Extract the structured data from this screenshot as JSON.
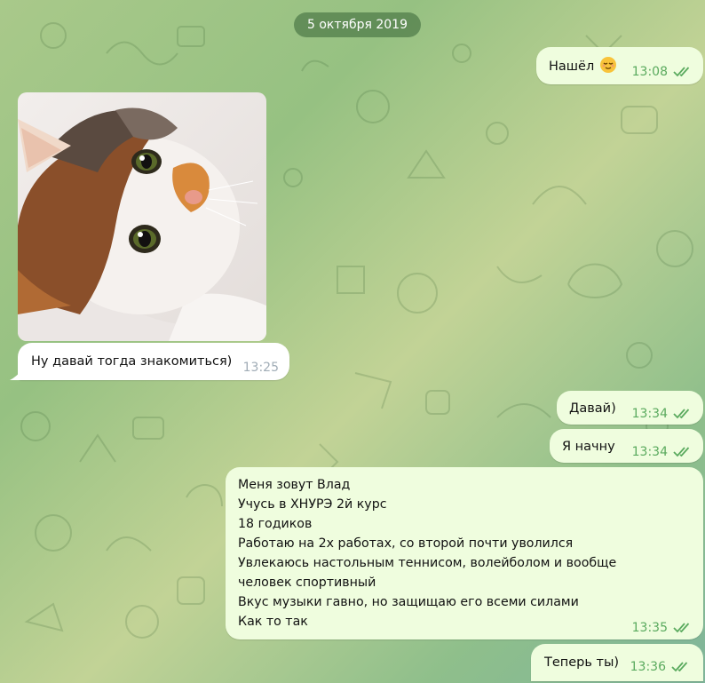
{
  "chat": {
    "date": "5 октября 2019",
    "messages": [
      {
        "text": "Нашёл",
        "emoji": "relieved-face",
        "time": "13:08",
        "direction": "out",
        "read": true
      },
      {
        "type": "photo",
        "subject": "cat photo",
        "direction": "in"
      },
      {
        "text": "Ну давай тогда знакомиться)",
        "time": "13:25",
        "direction": "in"
      },
      {
        "text": "Давай)",
        "time": "13:34",
        "direction": "out",
        "read": true
      },
      {
        "text": "Я начну",
        "time": "13:34",
        "direction": "out",
        "read": true
      },
      {
        "text": "Меня зовут Влад\nУчусь в ХНУРЭ 2й курс\n18 годиков\nРаботаю на 2х работах, со второй почти уволился\nУвлекаюсь настольным теннисом, волейболом и вообще\nчеловек спортивный\nВкус музыки гавно, но защищаю его всеми силами\nКак то так",
        "time": "13:35",
        "direction": "out",
        "read": true
      },
      {
        "text": "Теперь ты)",
        "time": "13:36",
        "direction": "out",
        "read": true
      }
    ]
  },
  "colors": {
    "outgoing_bubble": "#effdde",
    "incoming_bubble": "#ffffff",
    "outgoing_time": "#5aaa5e",
    "incoming_time": "#a0acb6",
    "date_pill": "#4e7a48"
  },
  "icons": {
    "read_receipt": "double-check-icon"
  }
}
